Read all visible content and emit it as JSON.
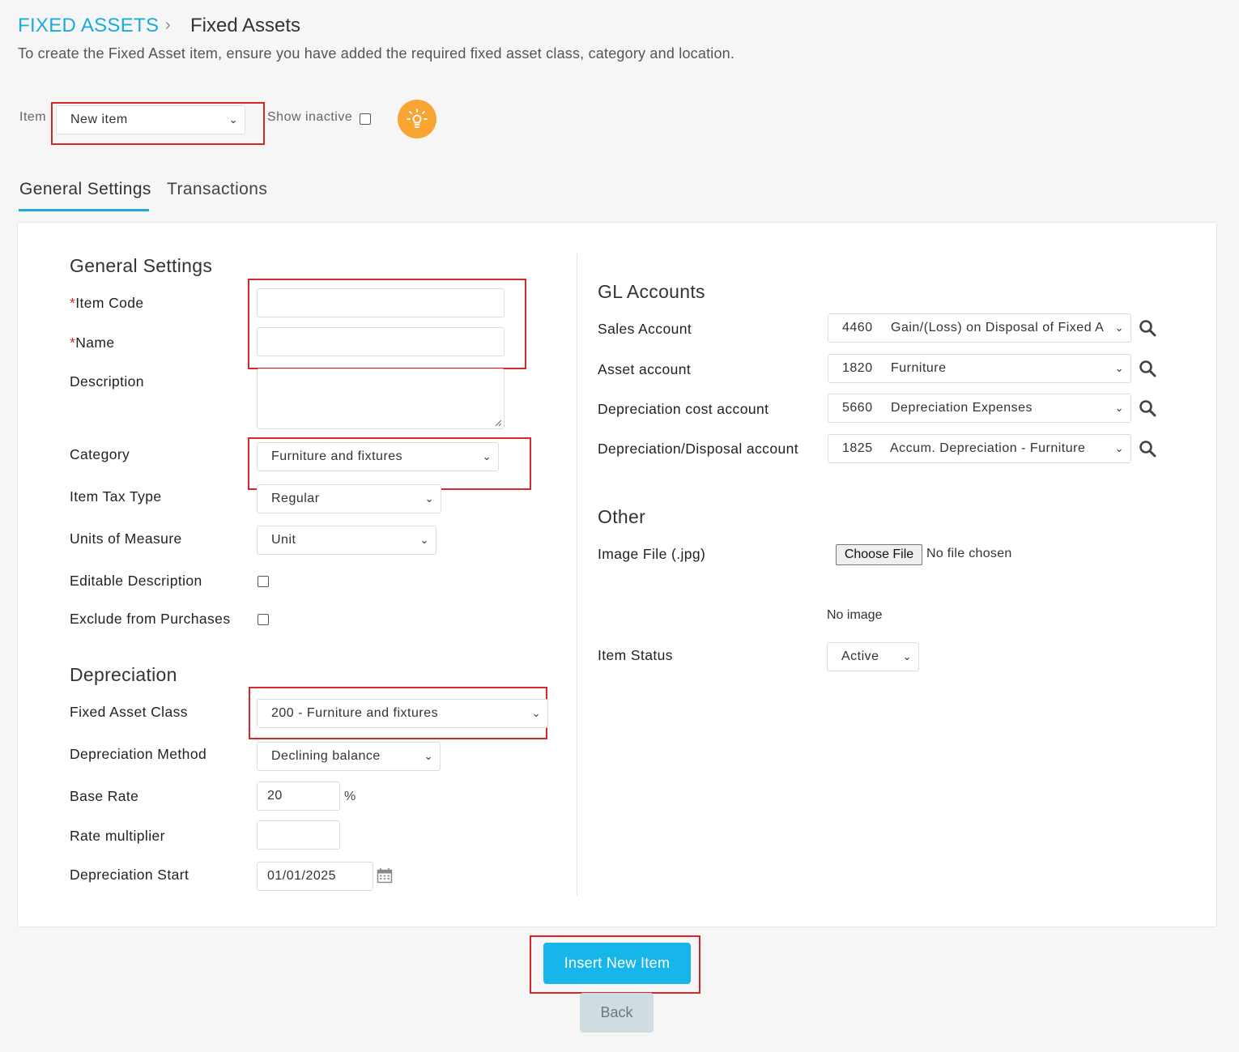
{
  "breadcrumb": {
    "root": "FIXED ASSETS",
    "separator": "›",
    "current": "Fixed Assets"
  },
  "subtitle": "To create the Fixed Asset item, ensure you have added the required fixed asset class, category and location.",
  "item_selector": {
    "label": "Item",
    "value": "New item",
    "show_inactive_label": "Show inactive"
  },
  "tabs": [
    {
      "label": "General Settings",
      "active": true
    },
    {
      "label": "Transactions",
      "active": false
    }
  ],
  "general": {
    "heading": "General Settings",
    "item_code_label": "Item Code",
    "name_label": "Name",
    "required_mark": "*",
    "description_label": "Description",
    "category_label": "Category",
    "category_value": "Furniture and fixtures",
    "tax_type_label": "Item Tax Type",
    "tax_type_value": "Regular",
    "uom_label": "Units of Measure",
    "uom_value": "Unit",
    "editable_desc_label": "Editable Description",
    "exclude_purchases_label": "Exclude from Purchases"
  },
  "depreciation": {
    "heading": "Depreciation",
    "class_label": "Fixed Asset Class",
    "class_value": "200 - Furniture and fixtures",
    "method_label": "Depreciation Method",
    "method_value": "Declining balance",
    "base_rate_label": "Base Rate",
    "base_rate_value": "20",
    "percent": "%",
    "multiplier_label": "Rate multiplier",
    "multiplier_value": "",
    "start_label": "Depreciation Start",
    "start_value": "01/01/2025"
  },
  "gl": {
    "heading": "GL Accounts",
    "accounts": [
      {
        "label": "Sales Account",
        "code": "4460",
        "name": "Gain/(Loss) on Disposal of Fixed A"
      },
      {
        "label": "Asset account",
        "code": "1820",
        "name": "Furniture"
      },
      {
        "label": "Depreciation cost account",
        "code": "5660",
        "name": "Depreciation Expenses"
      },
      {
        "label": "Depreciation/Disposal account",
        "code": "1825",
        "name": "Accum. Depreciation - Furniture"
      }
    ]
  },
  "other": {
    "heading": "Other",
    "image_label": "Image File (.jpg)",
    "choose_file": "Choose File",
    "no_file": "No file chosen",
    "no_image": "No image",
    "status_label": "Item Status",
    "status_value": "Active"
  },
  "buttons": {
    "insert": "Insert New Item",
    "back": "Back"
  },
  "colors": {
    "accent": "#1aa9e0",
    "highlight": "#d9262d",
    "bulb": "#f8a534"
  }
}
